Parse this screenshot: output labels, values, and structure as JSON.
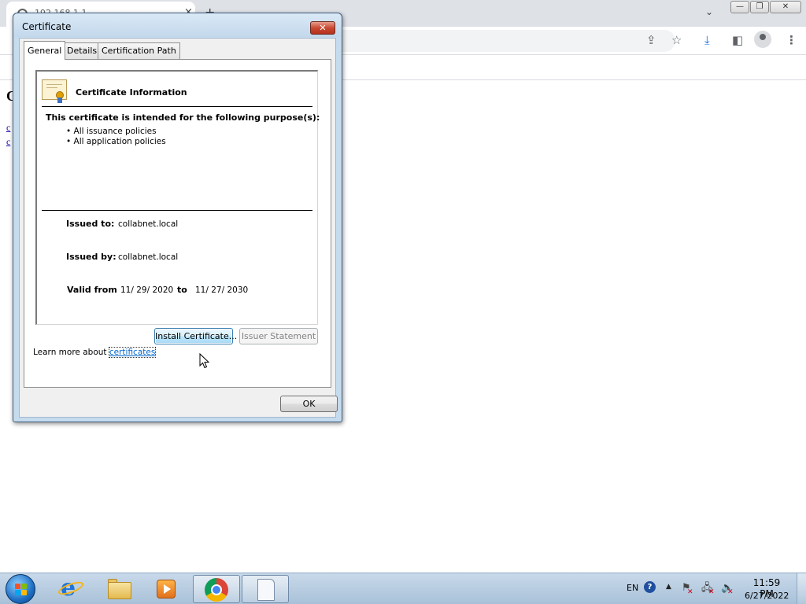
{
  "browser": {
    "tab_title": "192.168.1.1",
    "tab_close": "×",
    "new_tab": "+",
    "tab_search": "⌄",
    "window_minimize": "—",
    "window_maximize": "❐",
    "window_close": "✕",
    "toolbar_icons": {
      "share": "⇪",
      "star": "☆",
      "download": "⤓",
      "side_panel": "◧",
      "menu": "⋮"
    },
    "page": {
      "heading_letter": "C",
      "link_1": "c",
      "link_2": "c"
    }
  },
  "dialog": {
    "title": "Certificate",
    "close_label": "✕",
    "tabs": [
      {
        "label": "General",
        "selected": true
      },
      {
        "label": "Details",
        "selected": false
      },
      {
        "label": "Certification Path",
        "selected": false
      }
    ],
    "info_heading": "Certificate Information",
    "purpose_heading": "This certificate is intended for the following purpose(s):",
    "purposes": [
      "• All issuance policies",
      "• All application policies"
    ],
    "issued_to_label": "Issued to:",
    "issued_to_value": "collabnet.local",
    "issued_by_label": "Issued by:",
    "issued_by_value": "collabnet.local",
    "valid_from_label": "Valid from",
    "valid_from_value": "11/ 29/ 2020",
    "valid_to_word": "to",
    "valid_to_value": "11/ 27/ 2030",
    "install_button": "Install Certificate...",
    "issuer_button": "Issuer Statement",
    "learn_more_prefix": "Learn more about ",
    "learn_more_link": "certificates",
    "ok_button": "OK"
  },
  "taskbar": {
    "language": "EN",
    "help_glyph": "?",
    "tray_arrow": "▲",
    "tray_icons": {
      "flag": "⚑",
      "network": "🖧",
      "volume": "🔈"
    },
    "clock_time": "11:59 PM",
    "clock_date": "6/27/2022"
  },
  "colors": {
    "dialog_frame": "#c5dbee",
    "link": "#0066cc",
    "close_button": "#c94a33",
    "taskbar": "#b9cde1"
  }
}
